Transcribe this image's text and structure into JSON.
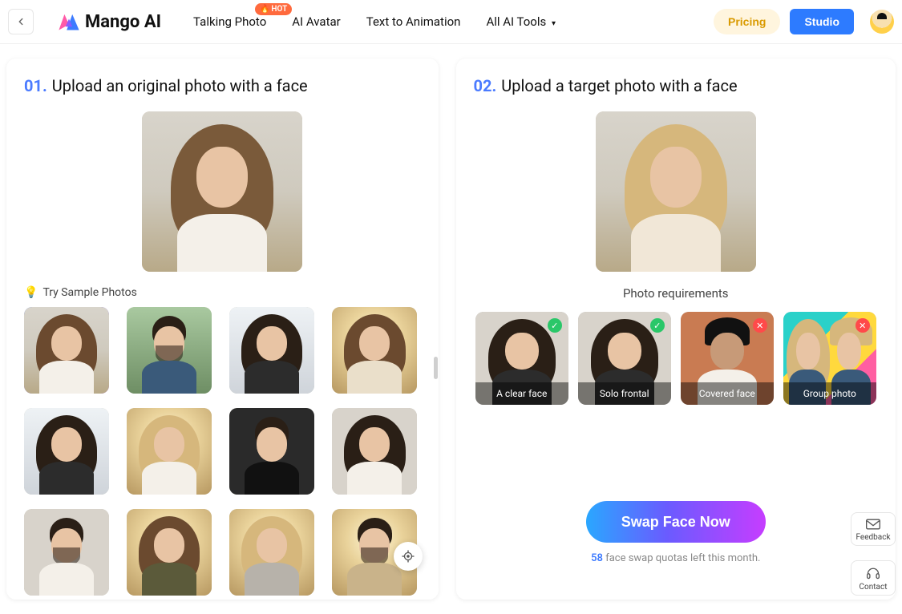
{
  "brand": {
    "name": "Mango AI"
  },
  "nav": {
    "talking_photo": "Talking Photo",
    "hot_badge": "HOT",
    "ai_avatar": "AI Avatar",
    "text_to_animation": "Text to Animation",
    "all_tools": "All AI Tools",
    "pricing": "Pricing",
    "studio": "Studio"
  },
  "left": {
    "step": "01.",
    "title": "Upload an original photo with a face",
    "samples_label": "Try Sample Photos"
  },
  "right": {
    "step": "02.",
    "title": "Upload a target photo with a face",
    "requirements_title": "Photo requirements",
    "reqs": {
      "r1": "A clear face",
      "r2": "Solo frontal",
      "r3": "Covered face",
      "r4": "Group photo"
    },
    "swap_button": "Swap Face Now",
    "quota_num": "58",
    "quota_text": " face swap quotas left this month."
  },
  "float": {
    "feedback": "Feedback",
    "contact": "Contact"
  }
}
